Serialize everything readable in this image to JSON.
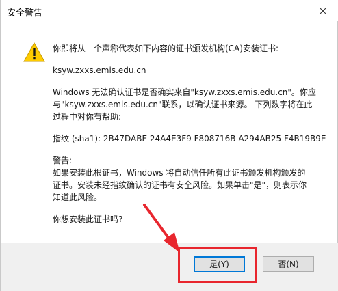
{
  "window": {
    "title": "安全警告",
    "close_glyph": "✕"
  },
  "message": {
    "intro": "你即将从一个声称代表如下内容的证书颁发机构(CA)安装证书:",
    "domain": "ksyw.zxxs.emis.edu.cn",
    "body_line1": "Windows 无法确认证书是否确实来自\"ksyw.zxxs.emis.edu.cn\"。你应",
    "body_line2": "与\"ksyw.zxxs.emis.edu.cn\"联系，以确认证书来源。 下列数字将在此",
    "body_line3": "过程中对你有帮助:",
    "thumbprint": "指纹 (sha1): 2B47DABE 24A4E3F9 F808716B A294AB25 F4B19B9E",
    "warning_label": "警告:",
    "warn_line1": "如果安装此根证书，Windows 将自动信任所有此证书颁发机构颁发的",
    "warn_line2": "证书。安装未经指纹确认的证书有安全风险。如果单击\"是\"，则表示你",
    "warn_line3": "知道此风险。",
    "question": "你想安装此证书吗?"
  },
  "buttons": {
    "yes": "是(Y)",
    "no": "否(N)"
  },
  "icons": {
    "warning": "warning-icon",
    "close": "close-icon"
  },
  "colors": {
    "annotation": "#e8262e",
    "warning_fill": "#ffcc00",
    "accent": "#0078d7"
  }
}
